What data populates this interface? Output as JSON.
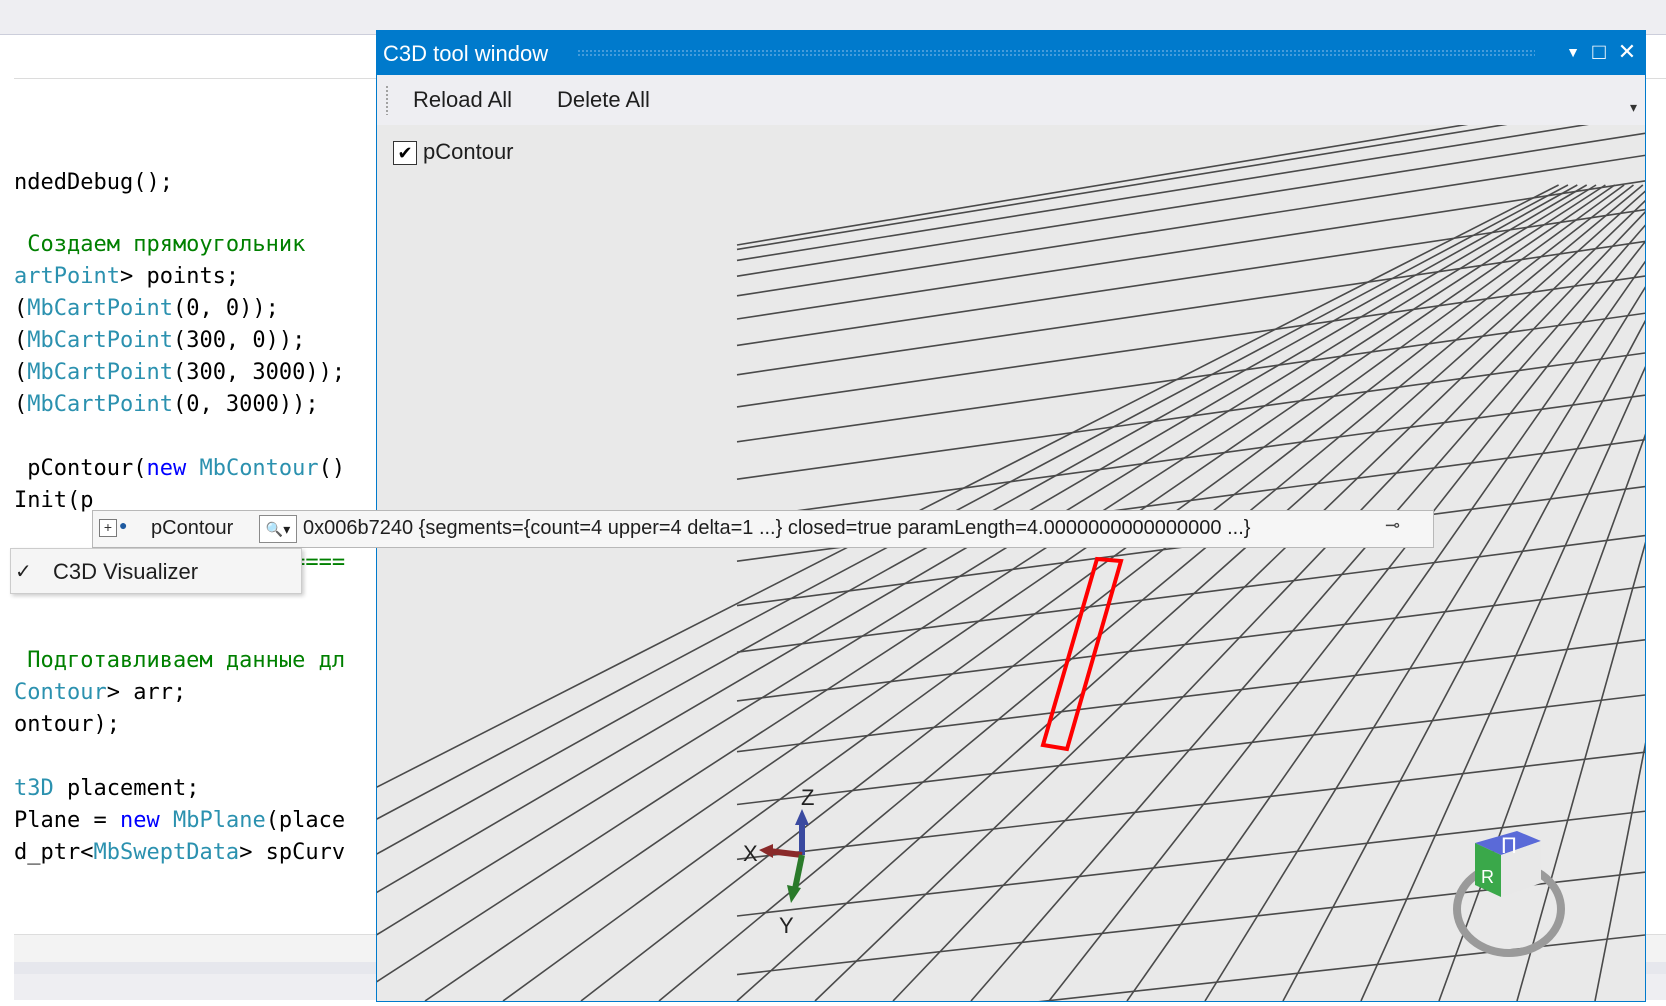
{
  "code_lines": [
    {
      "parts": [
        {
          "t": "ndedDebug();",
          "c": ""
        }
      ]
    },
    {
      "parts": [
        {
          "t": " Создаем прямоугольник",
          "c": "cmt"
        }
      ]
    },
    {
      "parts": [
        {
          "t": "artPoint",
          "c": "type"
        },
        {
          "t": "> points;",
          "c": ""
        }
      ]
    },
    {
      "parts": [
        {
          "t": "(",
          "c": ""
        },
        {
          "t": "MbCartPoint",
          "c": "type"
        },
        {
          "t": "(0, 0));",
          "c": ""
        }
      ]
    },
    {
      "parts": [
        {
          "t": "(",
          "c": ""
        },
        {
          "t": "MbCartPoint",
          "c": "type"
        },
        {
          "t": "(300, 0));",
          "c": ""
        }
      ]
    },
    {
      "parts": [
        {
          "t": "(",
          "c": ""
        },
        {
          "t": "MbCartPoint",
          "c": "type"
        },
        {
          "t": "(300, 3000));",
          "c": ""
        }
      ]
    },
    {
      "parts": [
        {
          "t": "(",
          "c": ""
        },
        {
          "t": "MbCartPoint",
          "c": "type"
        },
        {
          "t": "(0, 3000));",
          "c": ""
        }
      ]
    },
    {
      "parts": [
        {
          "t": " pContour(",
          "c": ""
        },
        {
          "t": "new",
          "c": "kw"
        },
        {
          "t": " ",
          "c": ""
        },
        {
          "t": "MbContour",
          "c": "type"
        },
        {
          "t": "()",
          "c": ""
        }
      ]
    },
    {
      "parts": [
        {
          "t": "Init(p",
          "c": ""
        }
      ]
    },
    {
      "parts": [
        {
          "t": "=========================",
          "c": "cmt"
        }
      ]
    },
    {
      "parts": [
        {
          "t": " Подготавливаем данные дл",
          "c": "cmt"
        }
      ]
    },
    {
      "parts": [
        {
          "t": "Contour",
          "c": "type"
        },
        {
          "t": "> arr;",
          "c": ""
        }
      ]
    },
    {
      "parts": [
        {
          "t": "ontour);",
          "c": ""
        }
      ]
    },
    {
      "parts": [
        {
          "t": "t3D",
          "c": "type"
        },
        {
          "t": " placement;",
          "c": ""
        }
      ]
    },
    {
      "parts": [
        {
          "t": "Plane = ",
          "c": ""
        },
        {
          "t": "new",
          "c": "kw"
        },
        {
          "t": " ",
          "c": ""
        },
        {
          "t": "MbPlane",
          "c": "type"
        },
        {
          "t": "(place",
          "c": ""
        }
      ]
    },
    {
      "parts": [
        {
          "t": "d_ptr<",
          "c": ""
        },
        {
          "t": "MbSweptData",
          "c": "type"
        },
        {
          "t": "> spCurv",
          "c": ""
        }
      ]
    }
  ],
  "tool_window": {
    "title": "C3D tool window",
    "dropdown_glyph": "▼",
    "maximize_glyph": "□",
    "close_glyph": "✕",
    "toolbar": {
      "reload_label": "Reload All",
      "delete_label": "Delete All",
      "overflow_glyph": "▾"
    },
    "list_item_label": "pContour",
    "list_item_checked": true,
    "check_glyph": "✔"
  },
  "viewport": {
    "axis_labels": {
      "x": "X",
      "y": "Y",
      "z": "Z"
    },
    "nav_cube_labels": {
      "top": "Π",
      "front": "R"
    },
    "contour_color": "#ff0000"
  },
  "datatip": {
    "expand_glyph": "+",
    "name": "pContour",
    "magnifier_glyph": "🔍▾",
    "value": "0x006b7240 {segments={count=4 upper=4 delta=1 ...} closed=true paramLength=4.0000000000000000 ...}",
    "pin_glyph": "⊸"
  },
  "context_menu": {
    "check_glyph": "✓",
    "item_label": "C3D Visualizer"
  },
  "colors": {
    "accent": "#007acc",
    "comment": "#008000",
    "type": "#2b91af",
    "keyword": "#0000ff"
  }
}
